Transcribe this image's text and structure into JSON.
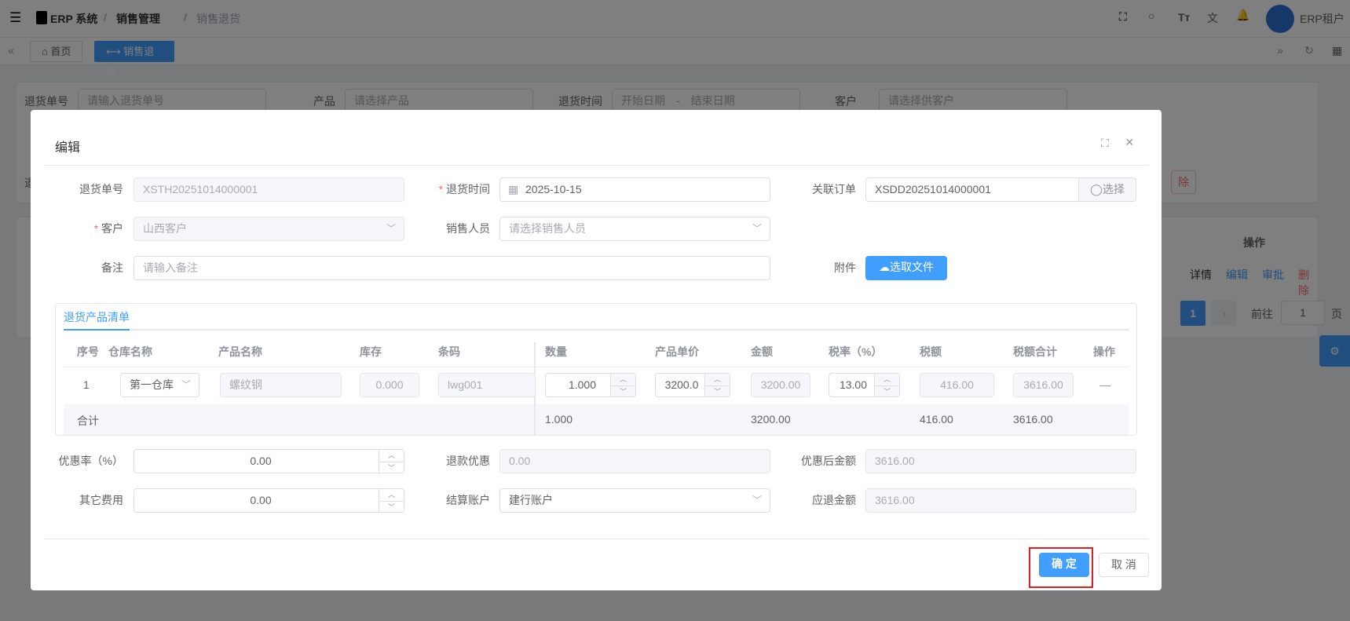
{
  "header": {
    "menu_icon": "hamburger-icon",
    "breadcrumb": [
      "ERP 系统",
      "销售管理",
      "销售退货"
    ],
    "user": "ERP租户",
    "icons": [
      "fullscreen-icon",
      "search-icon",
      "font-size-icon",
      "translate-icon",
      "bell-icon"
    ]
  },
  "tabs": {
    "home": "首页",
    "active": "销售退货"
  },
  "background": {
    "filters": {
      "return_no_label": "退货单号",
      "return_no_ph": "请输入退货单号",
      "product_label": "产品",
      "product_ph": "请选择产品",
      "time_label": "退货时间",
      "start_ph": "开始日期",
      "sep": "-",
      "end_ph": "结束日期",
      "customer_label": "客户",
      "customer_ph": "请选择供客户",
      "cut_label": "退",
      "delete_partial": "除"
    },
    "table": {
      "ops_header": "操作",
      "ops": [
        "详情",
        "编辑",
        "审批",
        "删除"
      ]
    },
    "pagination": {
      "page": "1",
      "goto": "前往",
      "goto_value": "1",
      "page_suffix": "页"
    }
  },
  "modal": {
    "title": "编辑",
    "fields": {
      "return_no_label": "退货单号",
      "return_no": "XSTH20251014000001",
      "time_label": "退货时间",
      "time": "2025-10-15",
      "order_label": "关联订单",
      "order": "XSDD20251014000001",
      "select_btn": "选择",
      "customer_label": "客户",
      "customer": "山西客户",
      "sales_label": "销售人员",
      "sales_ph": "请选择销售人员",
      "remark_label": "备注",
      "remark_ph": "请输入备注",
      "attach_label": "附件",
      "upload_btn": "选取文件"
    },
    "product_tab": "退货产品清单",
    "table": {
      "headers": [
        "序号",
        "仓库名称",
        "产品名称",
        "库存",
        "条码",
        "数量",
        "产品单价",
        "金额",
        "税率（%）",
        "税额",
        "税额合计",
        "操作"
      ],
      "row": {
        "index": "1",
        "warehouse": "第一仓库",
        "product": "螺纹钢",
        "stock": "0.000",
        "barcode": "lwg001",
        "qty": "1.000",
        "price": "3200.0",
        "amount": "3200.00",
        "tax_rate": "13.00",
        "tax": "416.00",
        "total": "3616.00",
        "op": "—"
      },
      "summary": {
        "label": "合计",
        "qty": "1.000",
        "amount": "3200.00",
        "tax": "416.00",
        "total": "3616.00"
      }
    },
    "bottom": {
      "discount_label": "优惠率（%）",
      "discount": "0.00",
      "refund_disc_label": "退款优惠",
      "refund_disc": "0.00",
      "after_label": "优惠后金额",
      "after": "3616.00",
      "other_label": "其它费用",
      "other": "0.00",
      "account_label": "结算账户",
      "account": "建行账户",
      "due_label": "应退金额",
      "due": "3616.00"
    },
    "confirm": "确 定",
    "cancel": "取 消"
  },
  "colors": {
    "primary": "#409eff",
    "highlight": "#e02020"
  }
}
